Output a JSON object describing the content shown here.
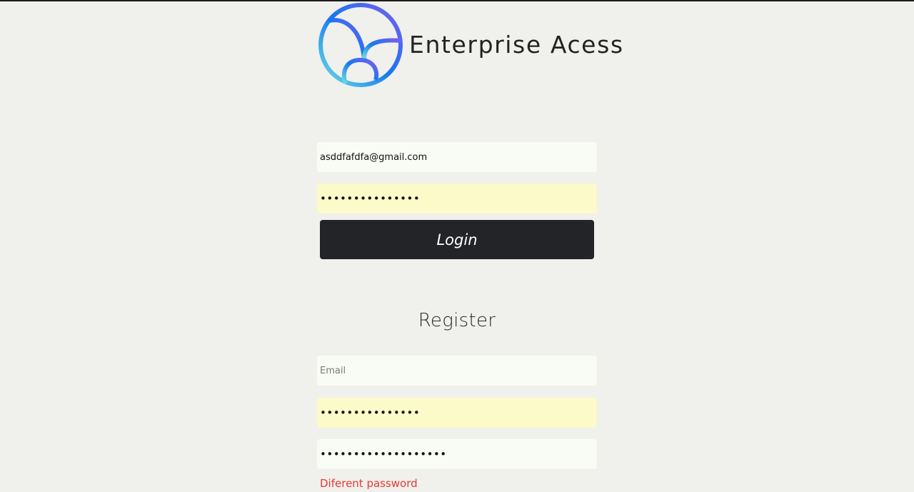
{
  "header": {
    "title": "Enterprise Acess",
    "logo_icon": "circle-arc-logo-icon",
    "logo_colors": [
      "#7b5cf0",
      "#1677f2",
      "#6de0e0"
    ]
  },
  "login": {
    "email_value": "asddfafdfa@gmail.com",
    "password_value": "•••••••••••••••",
    "button_label": "Login"
  },
  "register": {
    "title": "Register",
    "email_placeholder": "Email",
    "email_value": "",
    "password_value": "•••••••••••••••",
    "confirm_password_value": "•••••••••••••••••••",
    "error_message": "Diferent password"
  },
  "colors": {
    "background": "#f0f0ec",
    "button": "#232427",
    "autofill": "#fcfac8",
    "error": "#e53935"
  }
}
